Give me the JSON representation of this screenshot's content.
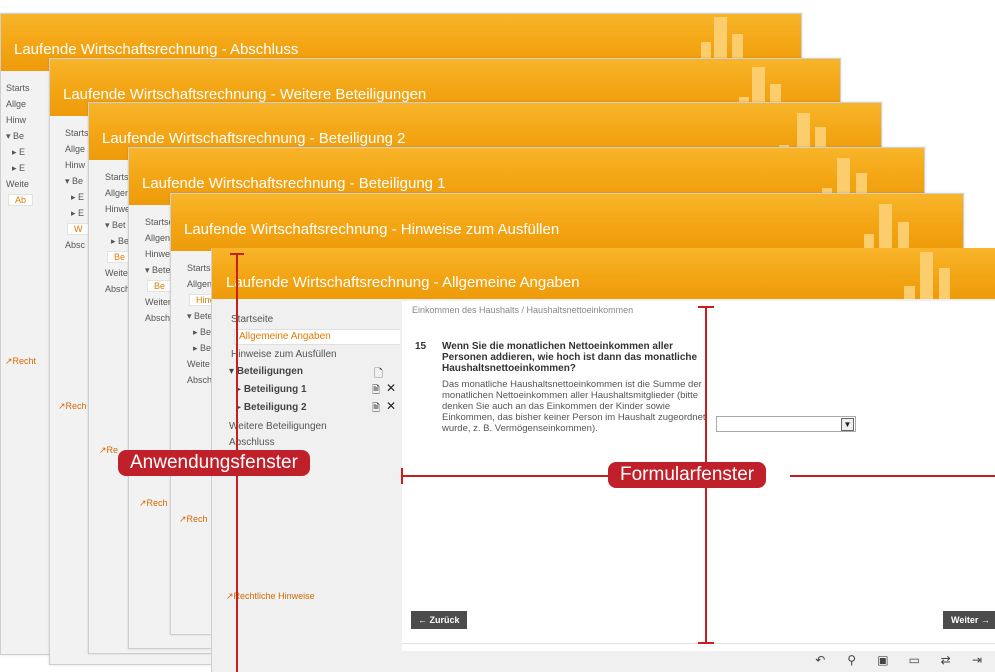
{
  "windows": [
    {
      "title": "Laufende Wirtschaftsrechnung - Abschluss",
      "nav": [
        "Starts",
        "Allge",
        "Hinw",
        "▾ Be",
        "▸ E",
        "▸ E",
        "Weite"
      ],
      "nav_selected": "Ab",
      "footer": "Recht"
    },
    {
      "title": "Laufende Wirtschaftsrechnung - Weitere Beteiligungen",
      "nav": [
        "Starts",
        "Allge",
        "Hinw",
        "▾ Be",
        "▸ E",
        "▸ E"
      ],
      "nav_selected": "W",
      "nav_after": "Absc",
      "footer": "Rech"
    },
    {
      "title": "Laufende Wirtschaftsrechnung - Beteiligung 2",
      "nav": [
        "Starts",
        "Allgen",
        "Hinwe",
        "▾ Bet",
        "▸ Be"
      ],
      "nav_selected": "Be",
      "nav_after": [
        "Weite",
        "Absch"
      ],
      "footer": "Re"
    },
    {
      "title": "Laufende Wirtschaftsrechnung - Beteiligung 1",
      "nav": [
        "Startse",
        "Allgen",
        "Hinwe",
        "▾ Bete"
      ],
      "nav_selected": "Be",
      "nav_after": [
        "Weiter",
        "Absch"
      ],
      "footer": "Rech"
    },
    {
      "title": "Laufende Wirtschaftsrechnung - Hinweise zum Ausfüllen",
      "nav": [
        "Starts",
        "Allgen"
      ],
      "nav_selected": "Hinw",
      "nav_after": [
        "▾ Bete",
        "▸ Be",
        "▸ Be",
        "Weite",
        "Absch"
      ],
      "footer": "Rech"
    }
  ],
  "front": {
    "title": "Laufende Wirtschaftsrechnung - Allgemeine Angaben",
    "nav": {
      "startseite": "Startseite",
      "allgemeine": "Allgemeine Angaben",
      "hinweise": "Hinweise zum Ausfüllen",
      "beteiligungen": "Beteiligungen",
      "beteiligung1": "Beteiligung 1",
      "beteiligung2": "Beteiligung 2",
      "weitere": "Weitere Beteiligungen",
      "abschluss": "Abschluss",
      "rechtliche": "Rechtliche Hinweise"
    },
    "form": {
      "breadcrumb": "Einkommen des Haushalts / Haushaltsnettoeinkommen",
      "question_number": "15",
      "question": "Wenn Sie die monatlichen Nettoeinkommen aller Personen addieren, wie hoch ist dann das monatliche Haushaltsnettoeinkommen?",
      "help": "Das monatliche Haushaltsnettoeinkommen ist die Summe der monatlichen Nettoeinkommen aller Haushaltsmitglieder (bitte denken Sie auch an das Einkommen der Kinder sowie Einkommen, das bisher keiner Person im Haushalt zugeordnet wurde, z. B. Vermögenseinkommen).",
      "select_value": "",
      "back": "← Zurück",
      "next": "Weiter →"
    },
    "toolbar": [
      "undo-icon",
      "search-icon",
      "save-icon",
      "open-folder-icon",
      "transfer-icon",
      "exit-icon"
    ]
  },
  "labels": {
    "app": "Anwendungsfenster",
    "form": "Formularfenster"
  },
  "colors": {
    "header": "#f3a514",
    "accent": "#e07b00",
    "annotation": "#c0202a",
    "button": "#4c4c4c"
  }
}
